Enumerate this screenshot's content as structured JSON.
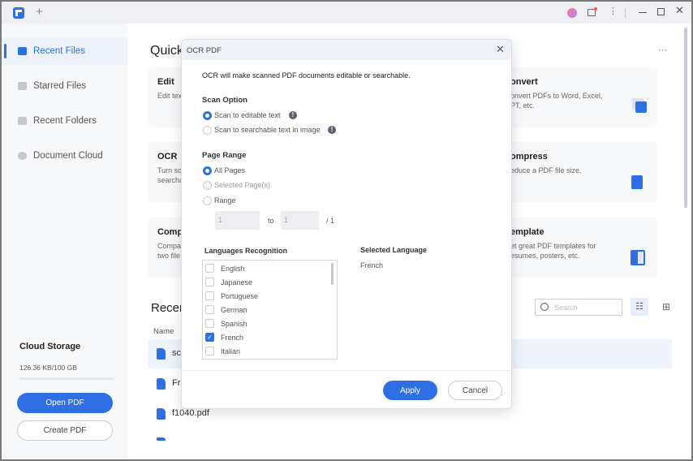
{
  "titlebar": {
    "new_tab": "+",
    "icons": [
      "app-logo-icon",
      "avatar-icon",
      "feedback-icon",
      "more-vertical-icon",
      "minimize-icon",
      "maximize-icon",
      "close-icon"
    ]
  },
  "sidebar": {
    "items": [
      {
        "label": "Recent Files",
        "active": true
      },
      {
        "label": "Starred Files"
      },
      {
        "label": "Recent Folders"
      },
      {
        "label": "Document Cloud"
      }
    ],
    "cloud_title": "Cloud Storage",
    "cloud_usage": "126.36 KB/100 GB",
    "cloud_usage_percent": 0.0001,
    "open_pdf": "Open PDF",
    "create_pdf": "Create PDF"
  },
  "main": {
    "quick_title": "Quick",
    "more": "···",
    "cards": [
      {
        "title": "Edit",
        "desc": "Edit tex"
      },
      {
        "title": "OCR",
        "desc": "Turn sc\nsearcha"
      },
      {
        "title": "Comp",
        "desc": "Compa\ntwo file"
      },
      {
        "title": "onvert",
        "desc": "onvert PDFs to Word, Excel,\nPT, etc."
      },
      {
        "title": "ompress",
        "desc": "educe a PDF file size."
      },
      {
        "title": "emplate",
        "desc": "et great PDF templates for\nesumes, posters, etc."
      }
    ],
    "recent_title": "Recen",
    "name_header": "Name",
    "search_placeholder": "Search",
    "files": [
      "sci",
      "Fra",
      "f1040.pdf"
    ]
  },
  "modal": {
    "title": "OCR PDF",
    "description": "OCR will make scanned PDF documents editable or searchable.",
    "scan_option_label": "Scan Option",
    "scan_options": [
      {
        "label": "Scan to editable text",
        "selected": true
      },
      {
        "label": "Scan to searchable text in image",
        "selected": false
      }
    ],
    "page_range_label": "Page Range",
    "page_range_options": [
      {
        "label": "All Pages",
        "selected": true
      },
      {
        "label": "Selected Page(s)",
        "selected": false
      },
      {
        "label": "Range",
        "selected": false
      }
    ],
    "range_from": "1",
    "range_to_label": "to",
    "range_to": "1",
    "range_total": "/ 1",
    "languages_label": "Languages Recognition",
    "languages": [
      {
        "label": "English",
        "checked": false
      },
      {
        "label": "Japanese",
        "checked": false
      },
      {
        "label": "Portuguese",
        "checked": false
      },
      {
        "label": "German",
        "checked": false
      },
      {
        "label": "Spanish",
        "checked": false
      },
      {
        "label": "French",
        "checked": true
      },
      {
        "label": "Italian",
        "checked": false
      }
    ],
    "selected_language_label": "Selected Language",
    "selected_language": "French",
    "apply": "Apply",
    "cancel": "Cancel"
  },
  "colors": {
    "accent": "#2f6fe4"
  }
}
